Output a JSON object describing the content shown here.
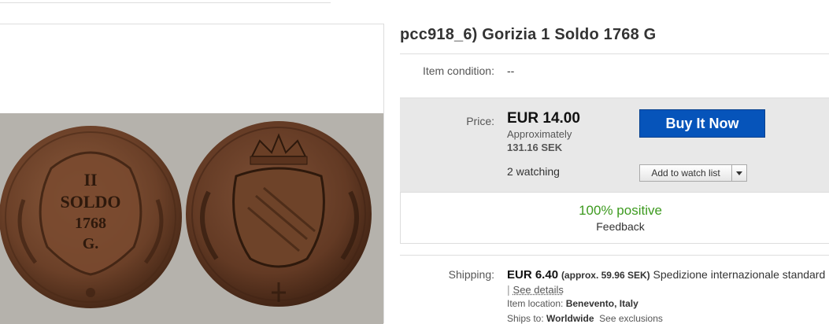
{
  "listing": {
    "title": "pcc918_6) Gorizia 1 Soldo 1768 G"
  },
  "condition": {
    "label": "Item condition:",
    "value": "--"
  },
  "price": {
    "label": "Price:",
    "value": "EUR 14.00",
    "approx_label": "Approximately",
    "approx_value": "131.16 SEK",
    "watching": "2 watching"
  },
  "actions": {
    "buy_now": "Buy It Now",
    "add_to_watch": "Add to watch list",
    "watch_dropdown_icon": "chevron-down-icon"
  },
  "seller": {
    "positive": "100% positive",
    "feedback": "Feedback"
  },
  "shipping": {
    "label": "Shipping:",
    "amount": "EUR 6.40",
    "approx": "(approx. 59.96 SEK)",
    "service": "Spedizione internazionale standard",
    "separator": "|",
    "see_details": "See details",
    "location_label": "Item location:",
    "location_value": "Benevento, Italy",
    "ships_to_label": "Ships to:",
    "ships_to_value": "Worldwide",
    "see_exclusions": "See exclusions"
  },
  "coin_obverse": {
    "legend": [
      "II",
      "SOLDO",
      "1768",
      "G."
    ]
  },
  "colors": {
    "buy_button": "#0654ba",
    "positive_text": "#3d9a1f",
    "price_box_bg": "#e8e8e8"
  }
}
